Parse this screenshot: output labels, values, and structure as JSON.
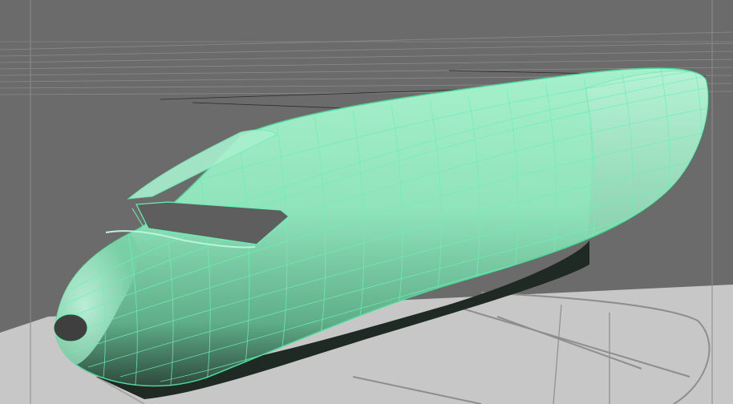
{
  "viewport": {
    "panel": "perspective-viewport",
    "background_color": "#6b6b6b",
    "floor_color": "#c9c9c9",
    "grid_color": "#8a8a8a",
    "wire_color": "#55e0a0"
  },
  "model": {
    "type": "polygon-mesh",
    "mesh_color": "#8fe6bd",
    "wire_color": "#6cf0b4",
    "selected": true
  },
  "reference_image": {
    "label": "blueprint-side-view",
    "visible": true
  }
}
